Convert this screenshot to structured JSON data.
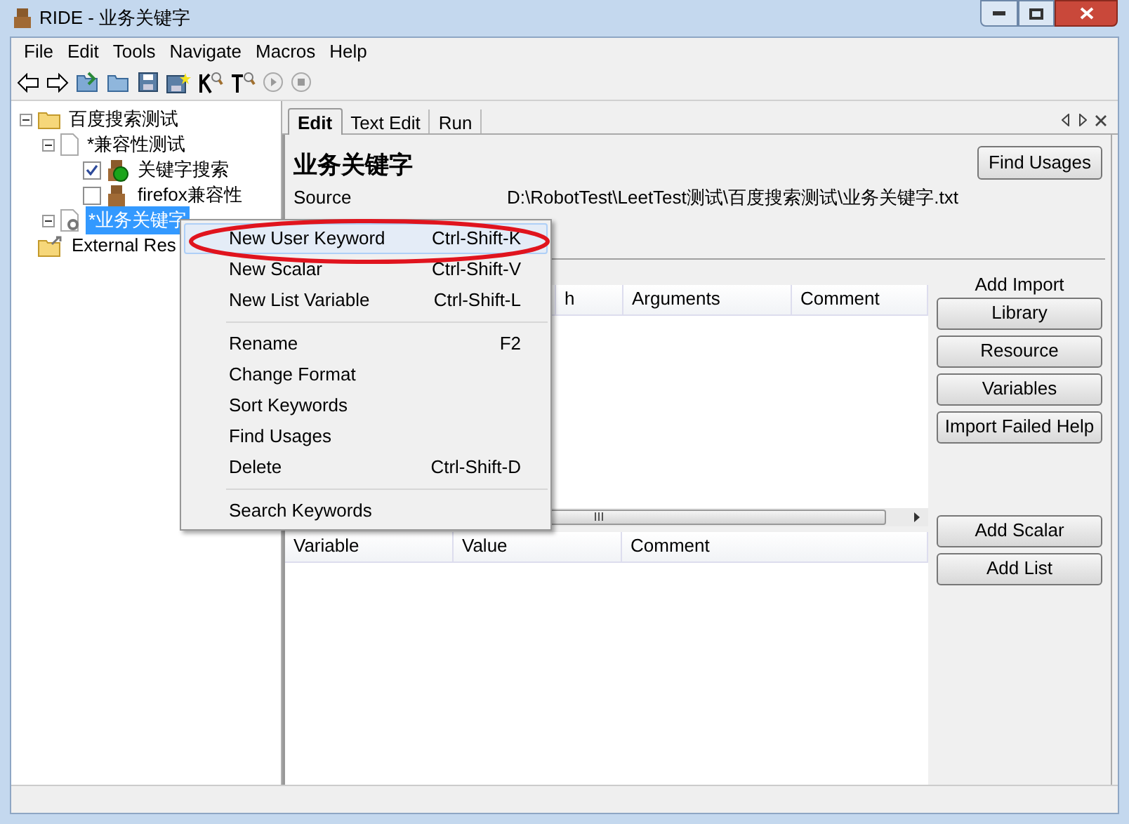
{
  "window": {
    "title": "RIDE - 业务关键字"
  },
  "menu_bar": [
    "File",
    "Edit",
    "Tools",
    "Navigate",
    "Macros",
    "Help"
  ],
  "tree": [
    {
      "label": "百度搜索测试",
      "kind": "folder",
      "expanded": true,
      "selected": false,
      "children": [
        {
          "label": "*兼容性测试",
          "kind": "suite",
          "expanded": true,
          "selected": false,
          "children": [
            {
              "label": "关键字搜索",
              "kind": "test",
              "checked": true,
              "passed": true,
              "selected": false
            },
            {
              "label": "firefox兼容性",
              "kind": "test",
              "checked": false,
              "passed": false,
              "selected": false
            }
          ]
        },
        {
          "label": "*业务关键字",
          "kind": "resource",
          "expanded": true,
          "selected": true
        }
      ]
    },
    {
      "label": "External Res",
      "kind": "external",
      "selected": false
    }
  ],
  "tabs": [
    {
      "label": "Edit",
      "selected": true
    },
    {
      "label": "Text Edit",
      "selected": false
    },
    {
      "label": "Run",
      "selected": false
    }
  ],
  "editor": {
    "title": "业务关键字",
    "find_usages": "Find Usages",
    "source_label": "Source",
    "source_path": "D:\\RobotTest\\LeetTest测试\\百度搜索测试\\业务关键字.txt",
    "import_columns": [
      "h",
      "Arguments",
      "Comment"
    ],
    "add_import_label": "Add Import",
    "import_buttons": [
      "Library",
      "Resource",
      "Variables",
      "Import Failed Help"
    ],
    "variable_columns": [
      "Variable",
      "Value",
      "Comment"
    ],
    "variable_buttons": [
      "Add Scalar",
      "Add List"
    ]
  },
  "context_menu": [
    [
      {
        "label": "New User Keyword",
        "shortcut": "Ctrl-Shift-K",
        "highlighted": true
      },
      {
        "label": "New Scalar",
        "shortcut": "Ctrl-Shift-V",
        "highlighted": false
      },
      {
        "label": "New List Variable",
        "shortcut": "Ctrl-Shift-L",
        "highlighted": false
      }
    ],
    [
      {
        "label": "Rename",
        "shortcut": "F2",
        "highlighted": false
      },
      {
        "label": "Change Format",
        "highlighted": false
      },
      {
        "label": "Sort Keywords",
        "highlighted": false
      },
      {
        "label": "Find Usages",
        "highlighted": false
      },
      {
        "label": "Delete",
        "shortcut": "Ctrl-Shift-D",
        "highlighted": false
      }
    ],
    [
      {
        "label": "Search Keywords",
        "highlighted": false
      }
    ]
  ]
}
